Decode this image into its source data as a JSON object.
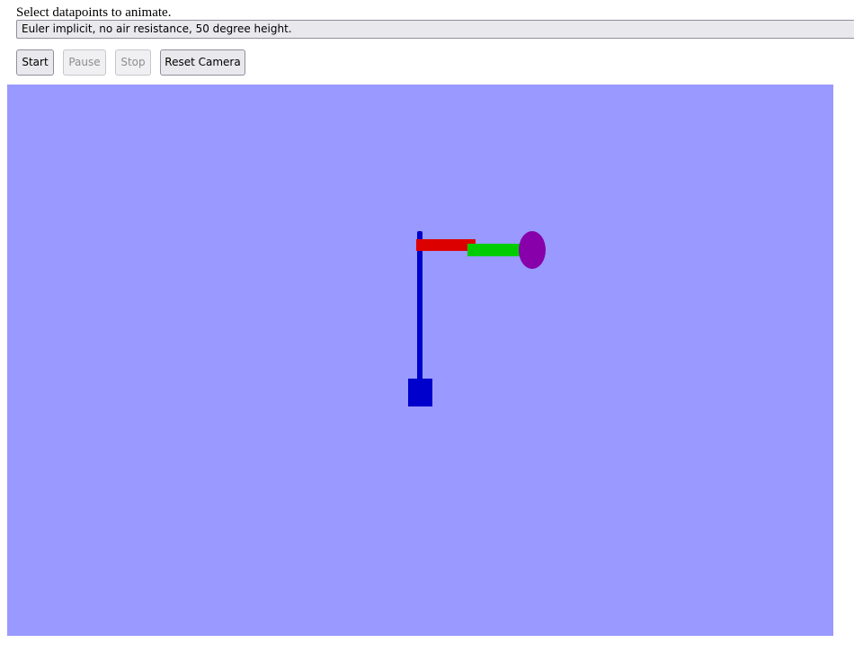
{
  "header": {
    "instruction": "Select datapoints to animate."
  },
  "dataset_select": {
    "selected": "Euler implicit, no air resistance, 50 degree height."
  },
  "controls": {
    "start_label": "Start",
    "pause_label": "Pause",
    "stop_label": "Stop",
    "reset_camera_label": "Reset Camera",
    "pause_enabled": false,
    "stop_enabled": false
  },
  "scene": {
    "background_color": "#9999ff",
    "base_color": "#0000cc",
    "pole_color": "#0000cc",
    "upper_arm_color": "#dd0000",
    "lower_arm_color": "#00cc00",
    "bob_color": "#8800aa"
  }
}
